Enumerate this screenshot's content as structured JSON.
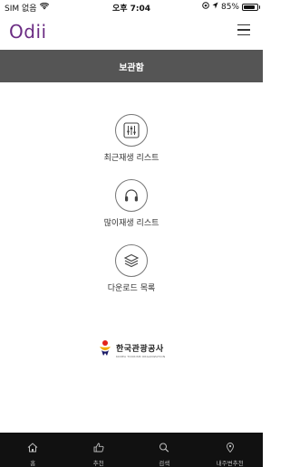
{
  "status_bar": {
    "carrier": "SIM 없음",
    "time": "오후 7:04",
    "battery_text": "85%",
    "battery_level": 0.85
  },
  "header": {
    "logo": "Odii",
    "logo_color": "#6b2c83"
  },
  "page": {
    "title": "보관함",
    "title_bar_color": "#555555"
  },
  "menu": {
    "items": [
      {
        "label": "최근재생 리스트",
        "icon": "equalizer-icon"
      },
      {
        "label": "많이재생 리스트",
        "icon": "headphones-icon"
      },
      {
        "label": "다운로드 목록",
        "icon": "layers-icon"
      }
    ]
  },
  "organization": {
    "name": "한국관광공사",
    "subtitle": "KOREA TOURISM ORGANIZATION"
  },
  "tab_bar": {
    "tabs": [
      {
        "label": "홈",
        "icon": "home-icon"
      },
      {
        "label": "추천",
        "icon": "thumbs-up-icon"
      },
      {
        "label": "검색",
        "icon": "search-icon"
      },
      {
        "label": "내주변추천",
        "icon": "location-pin-icon"
      }
    ]
  }
}
